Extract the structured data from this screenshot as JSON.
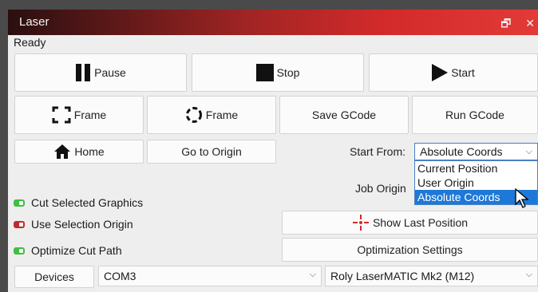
{
  "window": {
    "title": "Laser",
    "float_icon": "restore-icon",
    "close_icon": "close-icon"
  },
  "status": "Ready",
  "buttons": {
    "pause": "Pause",
    "stop": "Stop",
    "start": "Start",
    "frame_rect": "Frame",
    "frame_circle": "Frame",
    "save_gcode": "Save GCode",
    "run_gcode": "Run GCode",
    "home": "Home",
    "go_to_origin": "Go to Origin",
    "show_last_position": "Show Last Position",
    "optimization_settings": "Optimization Settings",
    "devices": "Devices"
  },
  "start_from": {
    "label": "Start From:",
    "value": "Absolute Coords",
    "options": [
      "Current Position",
      "User Origin",
      "Absolute Coords"
    ],
    "highlighted": "Absolute Coords"
  },
  "job_origin": {
    "label": "Job Origin"
  },
  "checkboxes": [
    {
      "label": "Cut Selected Graphics",
      "state": "on"
    },
    {
      "label": "Use Selection Origin",
      "state": "off"
    },
    {
      "label": "Optimize Cut Path",
      "state": "on"
    }
  ],
  "port": {
    "value": "COM3"
  },
  "device": {
    "value": "Roly LaserMATIC Mk2 (M12)"
  },
  "colors": {
    "title_dark": "#2a0f10",
    "title_red": "#e23a36",
    "toggle_on": "#3fbf3f",
    "toggle_off": "#c22a2a",
    "selection": "#1e78d7"
  }
}
